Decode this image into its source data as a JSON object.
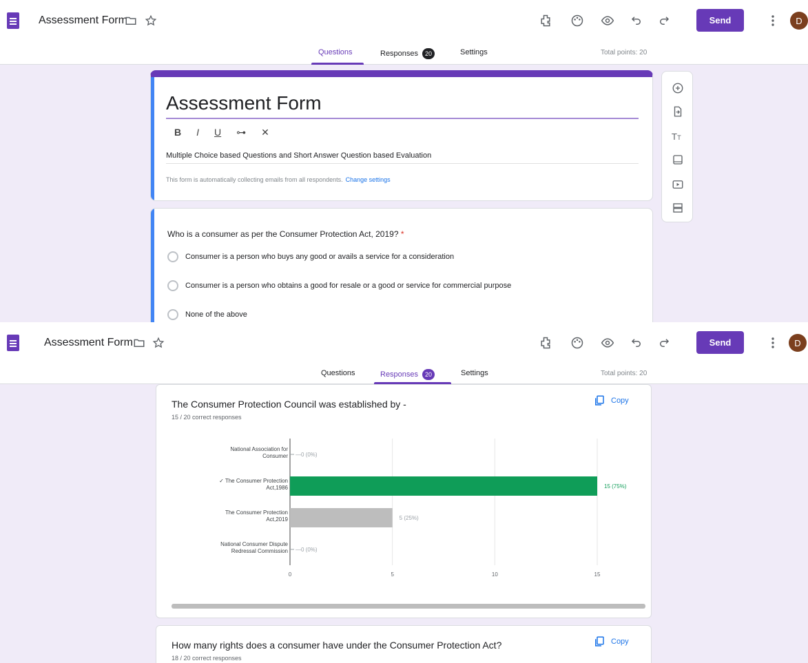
{
  "header": {
    "form_title": "Assessment Form",
    "send_label": "Send",
    "avatar_initial": "D",
    "tabs": [
      {
        "label": "Questions"
      },
      {
        "label": "Responses",
        "badge": "20"
      },
      {
        "label": "Settings"
      }
    ],
    "total_points": "Total points: 20"
  },
  "title_card": {
    "title": "Assessment Form",
    "description": "Multiple Choice based Questions and Short Answer Question based Evaluation",
    "collect_notice": "This form is automatically collecting emails from all respondents.",
    "change_settings": "Change settings",
    "format_buttons": [
      "B",
      "I",
      "U",
      "⊶",
      "✕"
    ]
  },
  "question": {
    "text": "Who is a consumer as per the Consumer Protection Act, 2019?",
    "required_mark": "*",
    "options": [
      "Consumer is a person who buys any good or avails a service for a consideration",
      "Consumer is a  person who obtains a good for resale or a good or service for commercial purpose",
      "None of the above"
    ]
  },
  "responses": {
    "q1": {
      "title": "The Consumer Protection Council was established by -",
      "subtitle": "15 / 20 correct responses",
      "copy_label": "Copy"
    },
    "q2": {
      "title": "How many rights does a consumer have under the Consumer Protection Act?",
      "subtitle": "18 / 20 correct responses",
      "copy_label": "Copy"
    }
  },
  "colors": {
    "accent": "#673ab7",
    "correct": "#0f9d58",
    "incorrect": "#bdbdbd",
    "link": "#1a73e8"
  },
  "chart_data": {
    "type": "bar",
    "orientation": "horizontal",
    "categories": [
      [
        "National Association for",
        "Consumer"
      ],
      [
        "✓ The Consumer Protection",
        "Act,1986"
      ],
      [
        "The Consumer Protection",
        "Act,2019"
      ],
      [
        "National Consumer Dispute",
        "Redressal Commission"
      ]
    ],
    "values": [
      0,
      15,
      5,
      0
    ],
    "value_labels": [
      "0 (0%)",
      "15 (75%)",
      "5 (25%)",
      "0 (0%)"
    ],
    "correct_index": 1,
    "xlim": [
      0,
      15
    ],
    "xticks": [
      "0",
      "5",
      "10",
      "15"
    ],
    "grid": true
  }
}
